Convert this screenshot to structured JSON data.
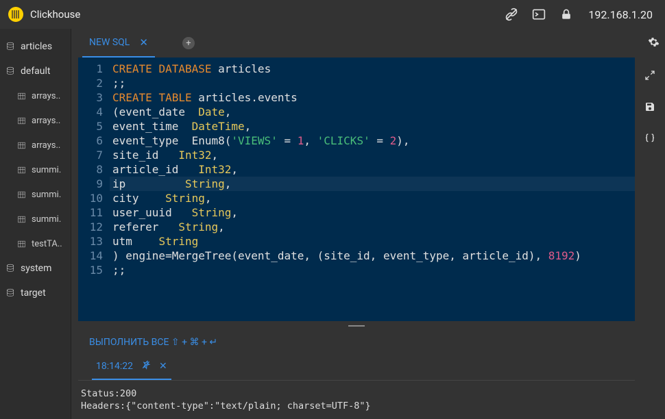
{
  "header": {
    "app_title": "Clickhouse",
    "ip": "192.168.1.20"
  },
  "sidebar": {
    "databases": [
      {
        "name": "articles",
        "tables": []
      },
      {
        "name": "default",
        "tables": [
          {
            "name": "arrays.."
          },
          {
            "name": "arrays.."
          },
          {
            "name": "arrays.."
          },
          {
            "name": "summi."
          },
          {
            "name": "summi."
          },
          {
            "name": "summi."
          },
          {
            "name": "testTA.."
          }
        ]
      },
      {
        "name": "system",
        "tables": []
      },
      {
        "name": "target",
        "tables": []
      }
    ]
  },
  "tabs": {
    "active": {
      "label": "NEW SQL"
    }
  },
  "editor": {
    "lines": [
      {
        "n": 1,
        "tokens": [
          [
            "kw",
            "CREATE"
          ],
          [
            "pl",
            " "
          ],
          [
            "kw",
            "DATABASE"
          ],
          [
            "pl",
            " articles"
          ]
        ]
      },
      {
        "n": 2,
        "tokens": [
          [
            "pl",
            ";;"
          ]
        ]
      },
      {
        "n": 3,
        "tokens": [
          [
            "kw",
            "CREATE"
          ],
          [
            "pl",
            " "
          ],
          [
            "kw",
            "TABLE"
          ],
          [
            "pl",
            " articles.events"
          ]
        ]
      },
      {
        "n": 4,
        "tokens": [
          [
            "pl",
            "(event_date  "
          ],
          [
            "ty",
            "Date"
          ],
          [
            "pl",
            ","
          ]
        ]
      },
      {
        "n": 5,
        "tokens": [
          [
            "pl",
            "event_time  "
          ],
          [
            "ty",
            "DateTime"
          ],
          [
            "pl",
            ","
          ]
        ]
      },
      {
        "n": 6,
        "tokens": [
          [
            "pl",
            "event_type  Enum8("
          ],
          [
            "str",
            "'VIEWS'"
          ],
          [
            "pl",
            " = "
          ],
          [
            "num",
            "1"
          ],
          [
            "pl",
            ", "
          ],
          [
            "str",
            "'CLICKS'"
          ],
          [
            "pl",
            " = "
          ],
          [
            "num",
            "2"
          ],
          [
            "pl",
            "),"
          ]
        ]
      },
      {
        "n": 7,
        "tokens": [
          [
            "pl",
            "site_id   "
          ],
          [
            "ty",
            "Int32"
          ],
          [
            "pl",
            ","
          ]
        ]
      },
      {
        "n": 8,
        "tokens": [
          [
            "pl",
            "article_id   "
          ],
          [
            "ty",
            "Int32"
          ],
          [
            "pl",
            ","
          ]
        ]
      },
      {
        "n": 9,
        "hl": true,
        "tokens": [
          [
            "pl",
            "ip         "
          ],
          [
            "ty",
            "String"
          ],
          [
            "pl",
            ","
          ]
        ]
      },
      {
        "n": 10,
        "tokens": [
          [
            "pl",
            "city    "
          ],
          [
            "ty",
            "String"
          ],
          [
            "pl",
            ","
          ]
        ]
      },
      {
        "n": 11,
        "tokens": [
          [
            "pl",
            "user_uuid   "
          ],
          [
            "ty",
            "String"
          ],
          [
            "pl",
            ","
          ]
        ]
      },
      {
        "n": 12,
        "tokens": [
          [
            "pl",
            "referer   "
          ],
          [
            "ty",
            "String"
          ],
          [
            "pl",
            ","
          ]
        ]
      },
      {
        "n": 13,
        "tokens": [
          [
            "pl",
            "utm    "
          ],
          [
            "ty",
            "String"
          ]
        ]
      },
      {
        "n": 14,
        "tokens": [
          [
            "pl",
            ") engine=MergeTree(event_date, (site_id, event_type, article_id), "
          ],
          [
            "num",
            "8192"
          ],
          [
            "pl",
            ")"
          ]
        ]
      },
      {
        "n": 15,
        "tokens": [
          [
            "pl",
            ";;"
          ]
        ]
      }
    ]
  },
  "run_bar": {
    "label": "ВЫПОЛНИТЬ ВСЕ ⇧ + ⌘ + ↵"
  },
  "result": {
    "tab_label": "18:14:22",
    "body": "Status:200\nHeaders:{\"content-type\":\"text/plain; charset=UTF-8\"}"
  }
}
